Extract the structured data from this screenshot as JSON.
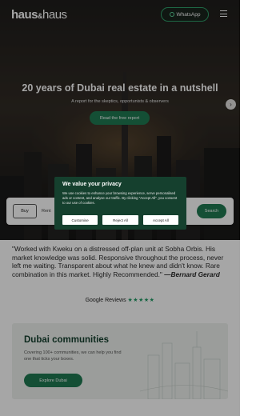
{
  "header": {
    "logo_bold": "haus",
    "logo_sep": "&",
    "logo_thin": "haus",
    "whatsapp_label": "WhatsApp"
  },
  "hero": {
    "title": "20 years of Dubai real estate in a nutshell",
    "subtitle": "A report for the skeptics, opportunists & observers",
    "cta_label": "Read the free report"
  },
  "search": {
    "tab_buy": "Buy",
    "tab_rent": "Rent",
    "button_label": "Search"
  },
  "cookie": {
    "title": "We value your privacy",
    "body": "We use cookies to enhance your browsing experience, serve personalised ads or content, and analyse our traffic. By clicking \"Accept All\", you consent to our use of cookies.",
    "customise_label": "Customise",
    "reject_label": "Reject All",
    "accept_label": "Accept All"
  },
  "testimonial": {
    "text": "\"Worked with Kweku on a distressed off-plan unit at Sobha Orbis. His market knowledge was solid. Responsive throughout the process, never left me waiting. Transparent about what he knew and didn't know. Rare combination in this market. Highly Recommended.\"",
    "author": "—Bernard Gerard"
  },
  "reviews": {
    "label": "Google Reviews",
    "stars": "★★★★★"
  },
  "communities": {
    "title": "Dubai communities",
    "body": "Covering 100+ communities, we can help you find one that ticks your boxes.",
    "cta_label": "Explore Dubai"
  },
  "colors": {
    "brand_green": "#1f7a52",
    "modal_green": "#15402e"
  }
}
